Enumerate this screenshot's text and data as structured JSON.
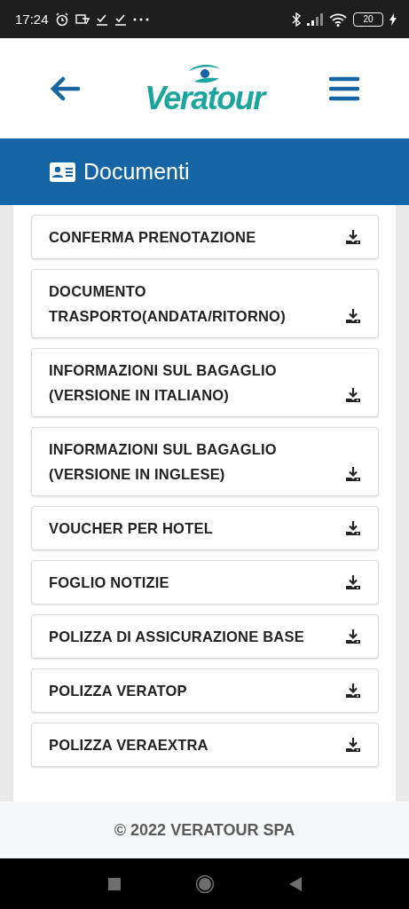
{
  "status_bar": {
    "time": "17:24",
    "battery": "20"
  },
  "header": {
    "logo": "Veratour"
  },
  "section": {
    "title": "Documenti"
  },
  "documents": [
    {
      "label": "CONFERMA PRENOTAZIONE"
    },
    {
      "label": "DOCUMENTO TRASPORTO(ANDATA/RITORNO)"
    },
    {
      "label": "INFORMAZIONI SUL BAGAGLIO (VERSIONE IN ITALIANO)"
    },
    {
      "label": "INFORMAZIONI SUL BAGAGLIO (VERSIONE IN INGLESE)"
    },
    {
      "label": "VOUCHER PER HOTEL"
    },
    {
      "label": "FOGLIO NOTIZIE"
    },
    {
      "label": "POLIZZA DI ASSICURAZIONE BASE"
    },
    {
      "label": "POLIZZA VERATOP"
    },
    {
      "label": "POLIZZA VERAEXTRA"
    }
  ],
  "footer": {
    "text": "© 2022 VERATOUR SPA"
  }
}
